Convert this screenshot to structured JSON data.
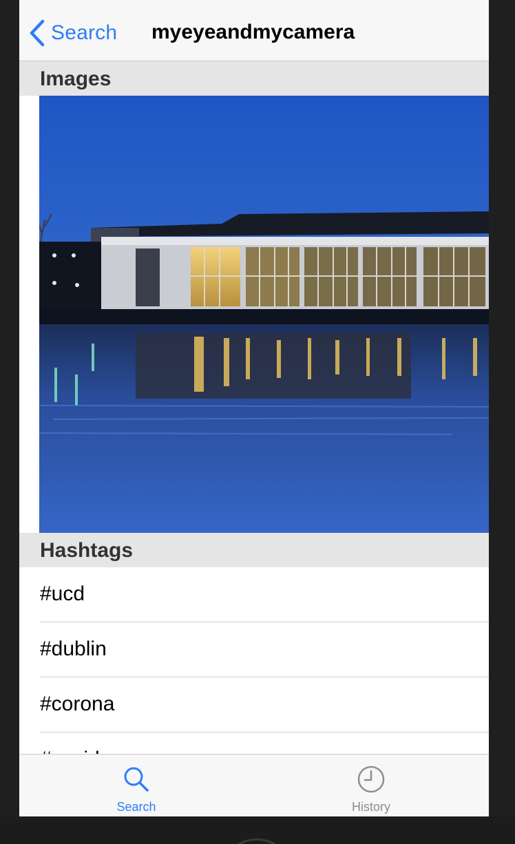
{
  "navbar": {
    "back_label": "Search",
    "title": "myeyeandmycamera"
  },
  "sections": {
    "images": "Images",
    "hashtags": "Hashtags"
  },
  "hashtags": [
    "#ucd",
    "#dublin",
    "#corona",
    "#covid"
  ],
  "tabbar": {
    "search_label": "Search",
    "history_label": "History",
    "active_color": "#2f7df6",
    "inactive_color": "#8e8e93"
  },
  "icons": {
    "back": "chevron-left-icon",
    "search": "search-icon",
    "history": "clock-icon"
  }
}
